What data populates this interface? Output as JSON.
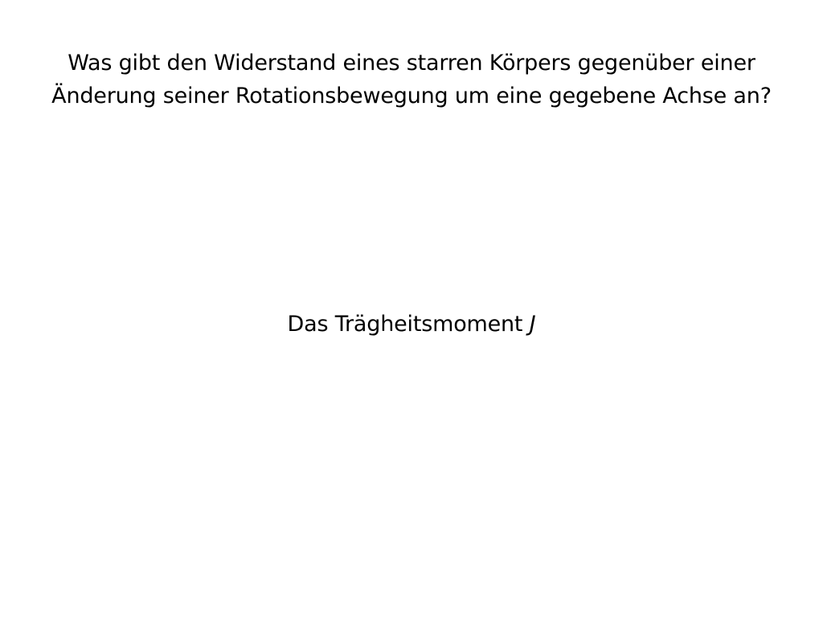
{
  "card": {
    "question_lines": [
      "Was gibt den Widerstand eines starren Körpers gegenüber einer",
      "Änderung seiner Rotationsbewegung um eine gegebene Achse an?"
    ],
    "answer": {
      "text": "Das Trägheitsmoment",
      "symbol": "J"
    }
  }
}
